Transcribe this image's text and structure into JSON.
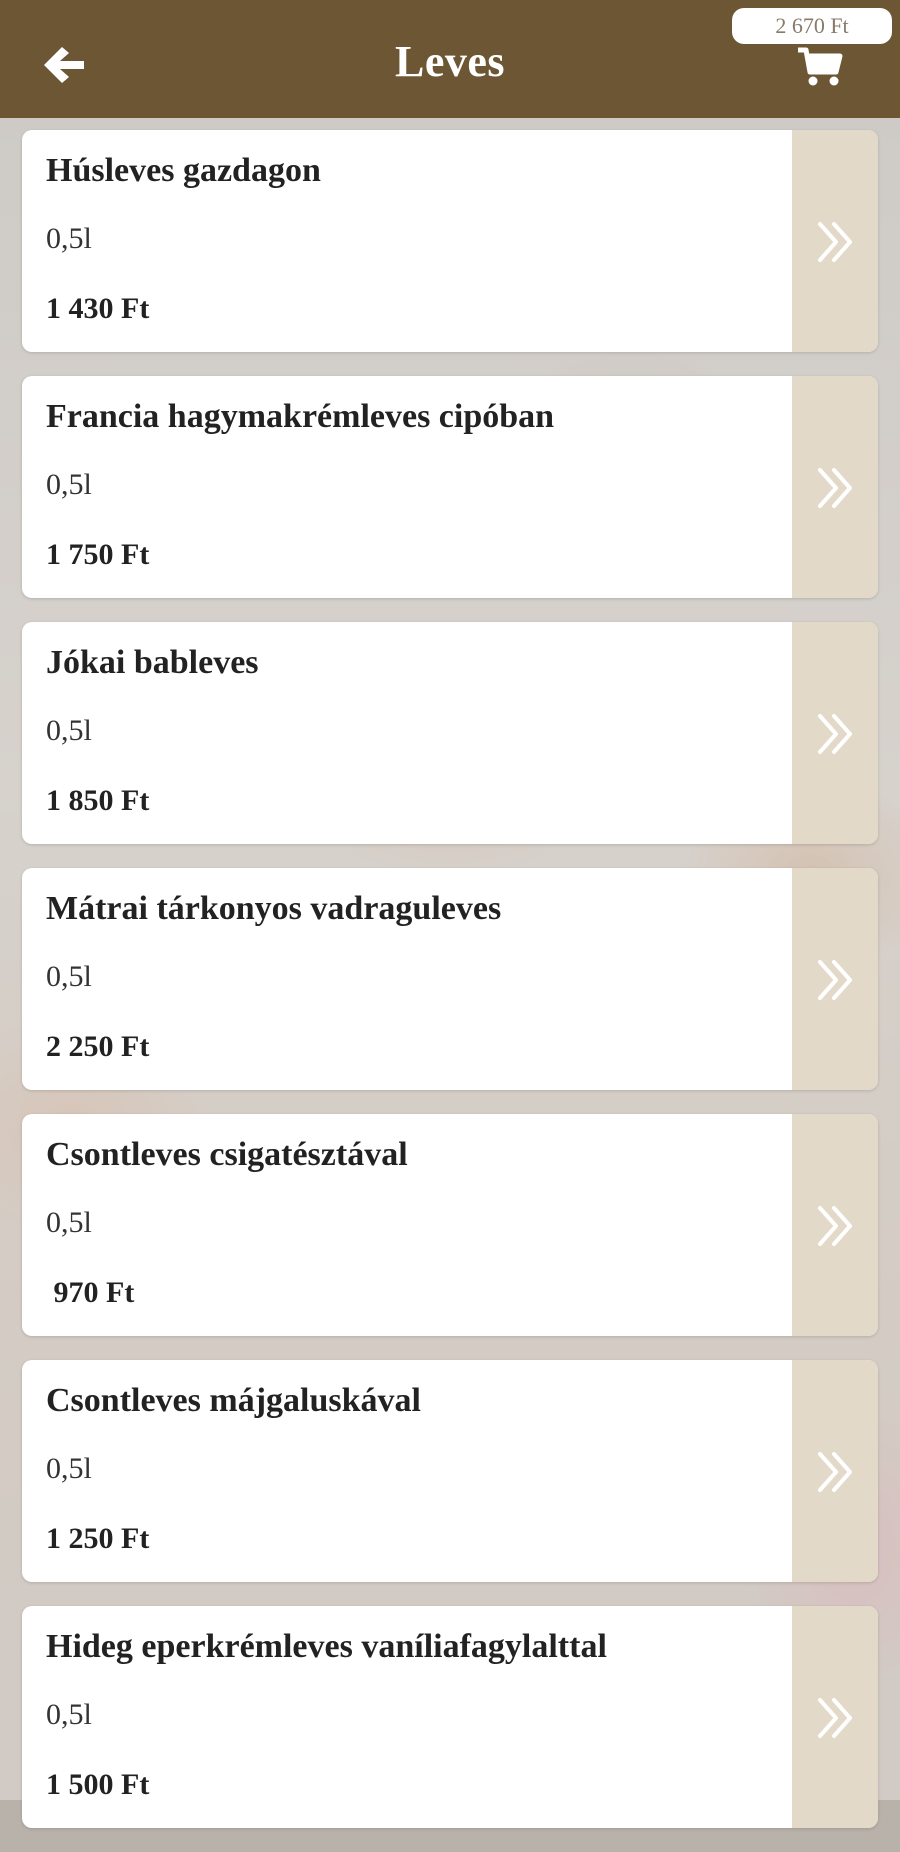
{
  "header": {
    "title": "Leves",
    "back_icon": "arrow-left-icon",
    "cart_icon": "shopping-cart-icon",
    "cart_total": "2 670 Ft",
    "background_color": "#6d5634"
  },
  "accent": {
    "action_panel_color": "#e3d9c8"
  },
  "items": [
    {
      "name": "Húsleves gazdagon",
      "volume": "0,5l",
      "price": "1 430 Ft"
    },
    {
      "name": "Francia hagymakrémleves cipóban",
      "volume": "0,5l",
      "price": "1 750 Ft"
    },
    {
      "name": "Jókai bableves",
      "volume": "0,5l",
      "price": "1 850 Ft"
    },
    {
      "name": "Mátrai tárkonyos vadraguleves",
      "volume": "0,5l",
      "price": "2 250 Ft"
    },
    {
      "name": "Csontleves csigatésztával",
      "volume": "0,5l",
      "price": " 970 Ft"
    },
    {
      "name": "Csontleves májgaluskával",
      "volume": "0,5l",
      "price": "1 250 Ft"
    },
    {
      "name": "Hideg eperkrémleves vaníliafagylalttal",
      "volume": "0,5l",
      "price": "1 500 Ft"
    }
  ]
}
